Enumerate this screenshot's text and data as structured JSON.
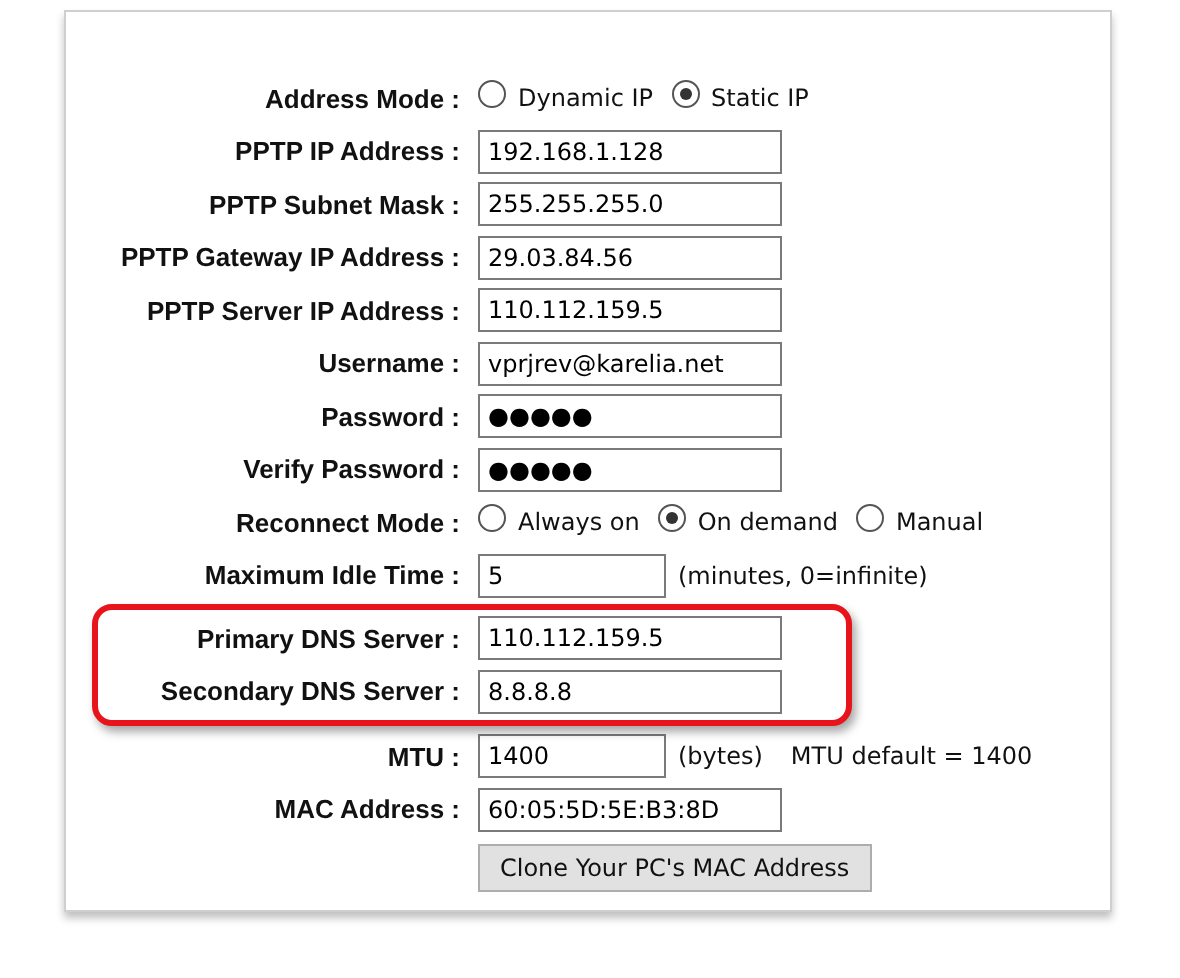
{
  "sections": [
    {
      "highlighted": false,
      "fields": [
        {
          "kind": "radio",
          "label": "Address Mode :",
          "options": [
            {
              "label": "Dynamic IP",
              "selected": false
            },
            {
              "label": "Static IP",
              "selected": true
            }
          ]
        },
        {
          "kind": "text",
          "label": "PPTP IP Address :",
          "value": "192.168.1.128"
        },
        {
          "kind": "text",
          "label": "PPTP Subnet Mask :",
          "value": "255.255.255.0"
        },
        {
          "kind": "text",
          "label": "PPTP Gateway IP Address :",
          "value": "29.03.84.56"
        },
        {
          "kind": "text",
          "label": "PPTP Server IP Address :",
          "value": "110.112.159.5"
        },
        {
          "kind": "text",
          "label": "Username :",
          "value": "vprjrev@karelia.net"
        },
        {
          "kind": "password",
          "label": "Password :",
          "value": "●●●●●"
        },
        {
          "kind": "password",
          "label": "Verify Password :",
          "value": "●●●●●"
        },
        {
          "kind": "radio",
          "label": "Reconnect Mode :",
          "options": [
            {
              "label": "Always on",
              "selected": false
            },
            {
              "label": "On demand",
              "selected": true
            },
            {
              "label": "Manual",
              "selected": false
            }
          ]
        },
        {
          "kind": "short",
          "label": "Maximum Idle Time :",
          "value": "5",
          "notes": [
            "(minutes, 0=infinite)"
          ]
        }
      ]
    },
    {
      "highlighted": true,
      "fields": [
        {
          "kind": "text",
          "label": "Primary DNS Server :",
          "value": "110.112.159.5"
        },
        {
          "kind": "text",
          "label": "Secondary DNS Server :",
          "value": "8.8.8.8"
        }
      ]
    },
    {
      "highlighted": false,
      "fields": [
        {
          "kind": "short",
          "label": "MTU :",
          "value": "1400",
          "notes": [
            "(bytes)",
            "MTU default = 1400"
          ]
        },
        {
          "kind": "text",
          "label": "MAC Address :",
          "value": "60:05:5D:5E:B3:8D"
        }
      ]
    }
  ],
  "button": "Clone Your PC's MAC Address"
}
